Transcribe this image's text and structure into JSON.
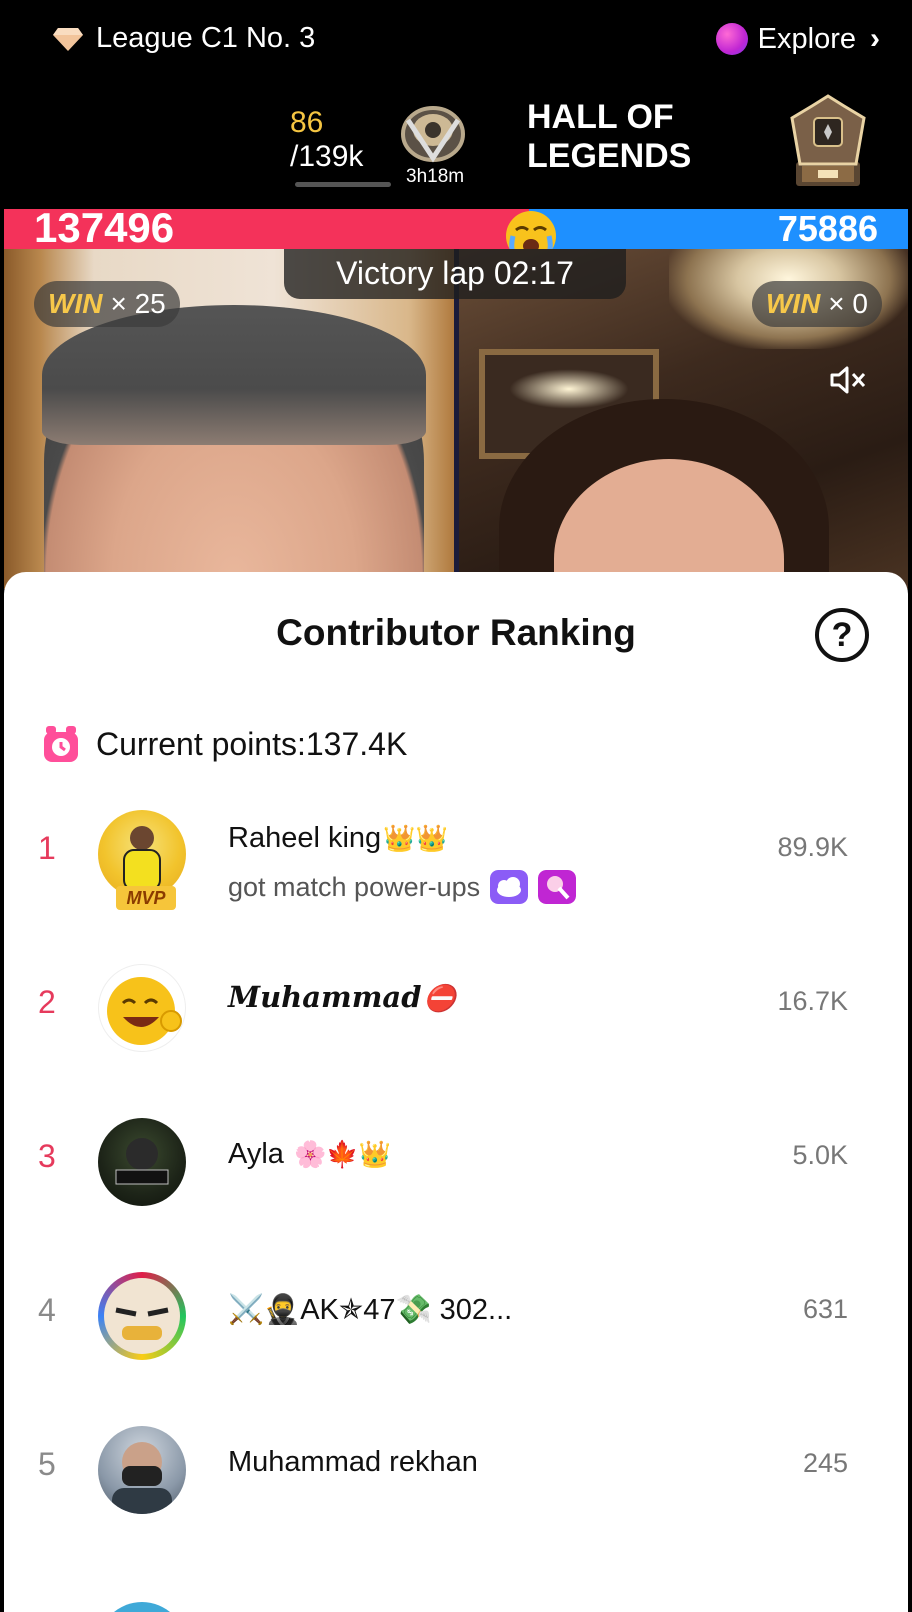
{
  "header": {
    "league": "League C1 No. 3",
    "explore": "Explore",
    "points_current": "86",
    "points_total": "/139k",
    "badge_time": "3h18m",
    "hall": "HALL OF LEGENDS"
  },
  "battle": {
    "score_left": "137496",
    "score_right": "75886",
    "victory": "Victory lap 02:17",
    "win_word": "WIN",
    "win_left": "× 25",
    "win_right": "× 0"
  },
  "ranking": {
    "title": "Contributor Ranking",
    "current_points": "Current points:137.4K",
    "rows": [
      {
        "rank": "1",
        "name": "Raheel king",
        "emoji": "👑👑",
        "sub": "got match power-ups",
        "score": "89.9K",
        "badge": "MVP"
      },
      {
        "rank": "2",
        "name": "𝑴𝒖𝒉𝒂𝒎𝒎𝒂𝒅",
        "emoji": "⛔",
        "score": "16.7K"
      },
      {
        "rank": "3",
        "name": "Ayla",
        "emoji": "🌸🍁👑",
        "score": "5.0K"
      },
      {
        "rank": "4",
        "name": "⚔️🥷AK✯47💸 302...",
        "emoji": "",
        "score": "631"
      },
      {
        "rank": "5",
        "name": "Muhammad rekhan",
        "emoji": "",
        "score": "245"
      }
    ]
  },
  "colors": {
    "red": "#f4325a",
    "blue": "#1e90ff",
    "rank_accent": "#e63a5c",
    "gold": "#f5c542"
  }
}
